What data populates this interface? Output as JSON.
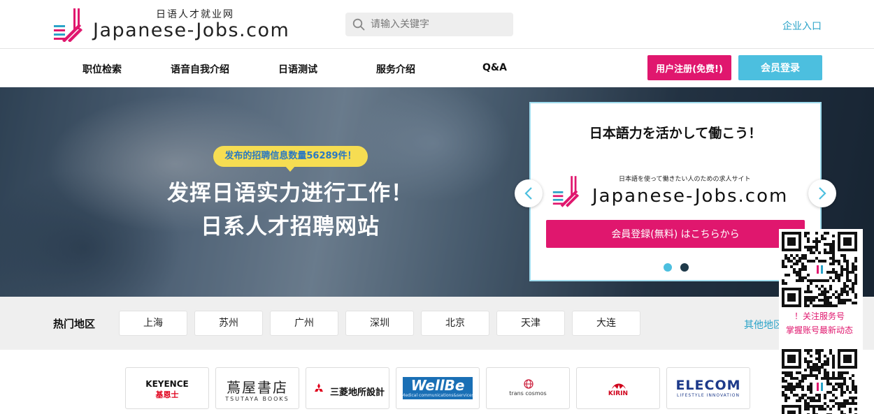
{
  "header": {
    "logo_sub": "日语人才就业网",
    "logo_text": "Japanese-Jobs.com",
    "search_placeholder": "请输入关键字",
    "corp_link": "企业入口"
  },
  "nav": {
    "items": [
      {
        "label": "职位检索"
      },
      {
        "label": "语音自我介绍"
      },
      {
        "label": "日语测试"
      },
      {
        "label": "服务介绍"
      },
      {
        "label": "Q&A"
      }
    ],
    "register": "用户注册(免费!)",
    "login": "会员登录"
  },
  "hero": {
    "badge": "发布的招聘信息数量56289件！",
    "title1": "发挥日语实力进行工作！",
    "title2": "日系人才招聘网站"
  },
  "card": {
    "title": "日本語力を活かして働こう！",
    "tagline": "日本語を使って働きたい人のための求人サイト",
    "logo_text": "Japanese-Jobs.com",
    "button": "会員登録(無料) はこちらから",
    "active_slide": 1,
    "slides": 2
  },
  "regions": {
    "title": "热门地区",
    "items": [
      "上海",
      "苏州",
      "广州",
      "深圳",
      "北京",
      "天津",
      "大连"
    ],
    "other": "其他地区"
  },
  "companies": [
    {
      "name": "KEYENCE",
      "sub": "基恩士",
      "color": "#e0001b"
    },
    {
      "name": "蔦屋書店",
      "sub": "TSUTAYA BOOKS",
      "color": "#222222"
    },
    {
      "name": "三菱地所設計",
      "sub": "",
      "color": "#111111"
    },
    {
      "name": "WellBe",
      "sub": "Medical communications&services",
      "color": "#1a6fb5"
    },
    {
      "name": "trans cosmos",
      "sub": "",
      "color": "#333333"
    },
    {
      "name": "KIRIN",
      "sub": "",
      "color": "#d0021b"
    },
    {
      "name": "ELECOM",
      "sub": "LIFESTYLE INNOVATION",
      "color": "#1d3a8a"
    }
  ],
  "qr": {
    "line1": "！关注服务号",
    "line2": "掌握账号最新动态"
  },
  "colors": {
    "accent_pink": "#e0176e",
    "accent_cyan": "#4cbfdf",
    "link": "#2aa3c8"
  }
}
